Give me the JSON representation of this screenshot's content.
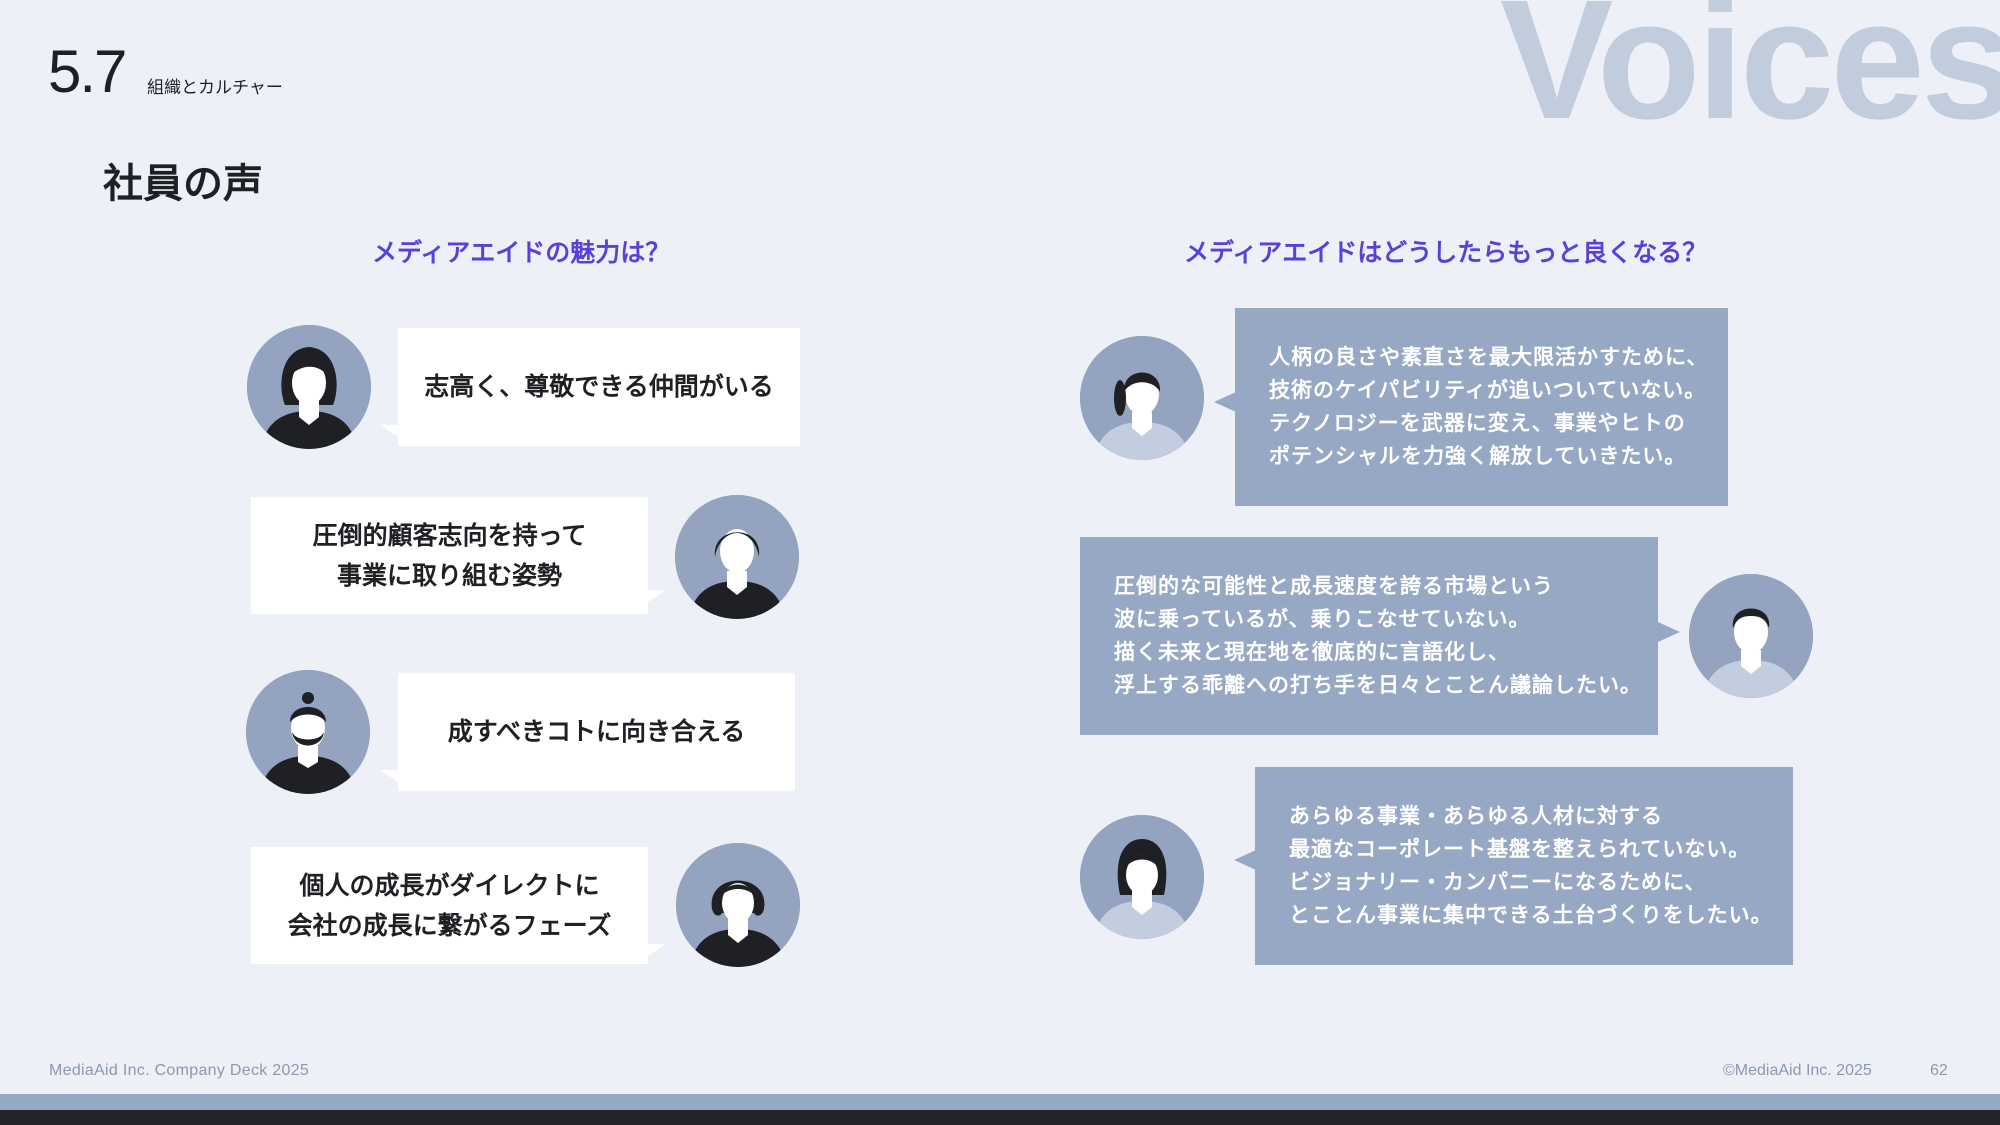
{
  "header": {
    "section_number": "5.7",
    "section_label": "組織とカルチャー",
    "watermark": "Voices",
    "page_title": "社員の声"
  },
  "left": {
    "heading": "メディアエイドの魅力は？",
    "items": [
      {
        "lines": [
          "志高く、尊敬できる仲間がいる"
        ]
      },
      {
        "lines": [
          "圧倒的顧客志向を持って",
          "事業に取り組む姿勢"
        ]
      },
      {
        "lines": [
          "成すべきコトに向き合える"
        ]
      },
      {
        "lines": [
          "個人の成長がダイレクトに",
          "会社の成長に繋がるフェーズ"
        ]
      }
    ]
  },
  "right": {
    "heading": "メディアエイドはどうしたらもっと良くなる？",
    "items": [
      {
        "lines": [
          "人柄の良さや素直さを最大限活かすために、",
          "技術のケイパビリティが追いついていない。",
          "テクノロジーを武器に変え、事業やヒトの",
          "ポテンシャルを力強く解放していきたい。"
        ]
      },
      {
        "lines": [
          "圧倒的な可能性と成長速度を誇る市場という",
          "波に乗っているが、乗りこなせていない。",
          "描く未来と現在地を徹底的に言語化し、",
          "浮上する乖離への打ち手を日々とことん議論したい。"
        ]
      },
      {
        "lines": [
          "あらゆる事業・あらゆる人材に対する",
          "最適なコーポレート基盤を整えられていない。",
          "ビジョナリー・カンパニーになるために、",
          "とことん事業に集中できる土台づくりをしたい。"
        ]
      }
    ]
  },
  "footer": {
    "left": "MediaAid Inc. Company Deck 2025",
    "right": "©MediaAid Inc. 2025",
    "page_number": "62"
  },
  "colors": {
    "accent": "#5b3fd9",
    "bubble_blue": "#97a8c5",
    "avatar_bg": "#93a3c0",
    "background": "#edf1f7",
    "watermark": "#c1ccdc"
  },
  "icons": {
    "avatars": [
      "female-long-hair-avatar-icon",
      "female-short-hair-avatar-icon",
      "male-bearded-avatar-icon",
      "female-bob-avatar-icon",
      "female-ponytail-avatar-icon",
      "male-short-hair-avatar-icon",
      "female-avatar-icon"
    ]
  }
}
